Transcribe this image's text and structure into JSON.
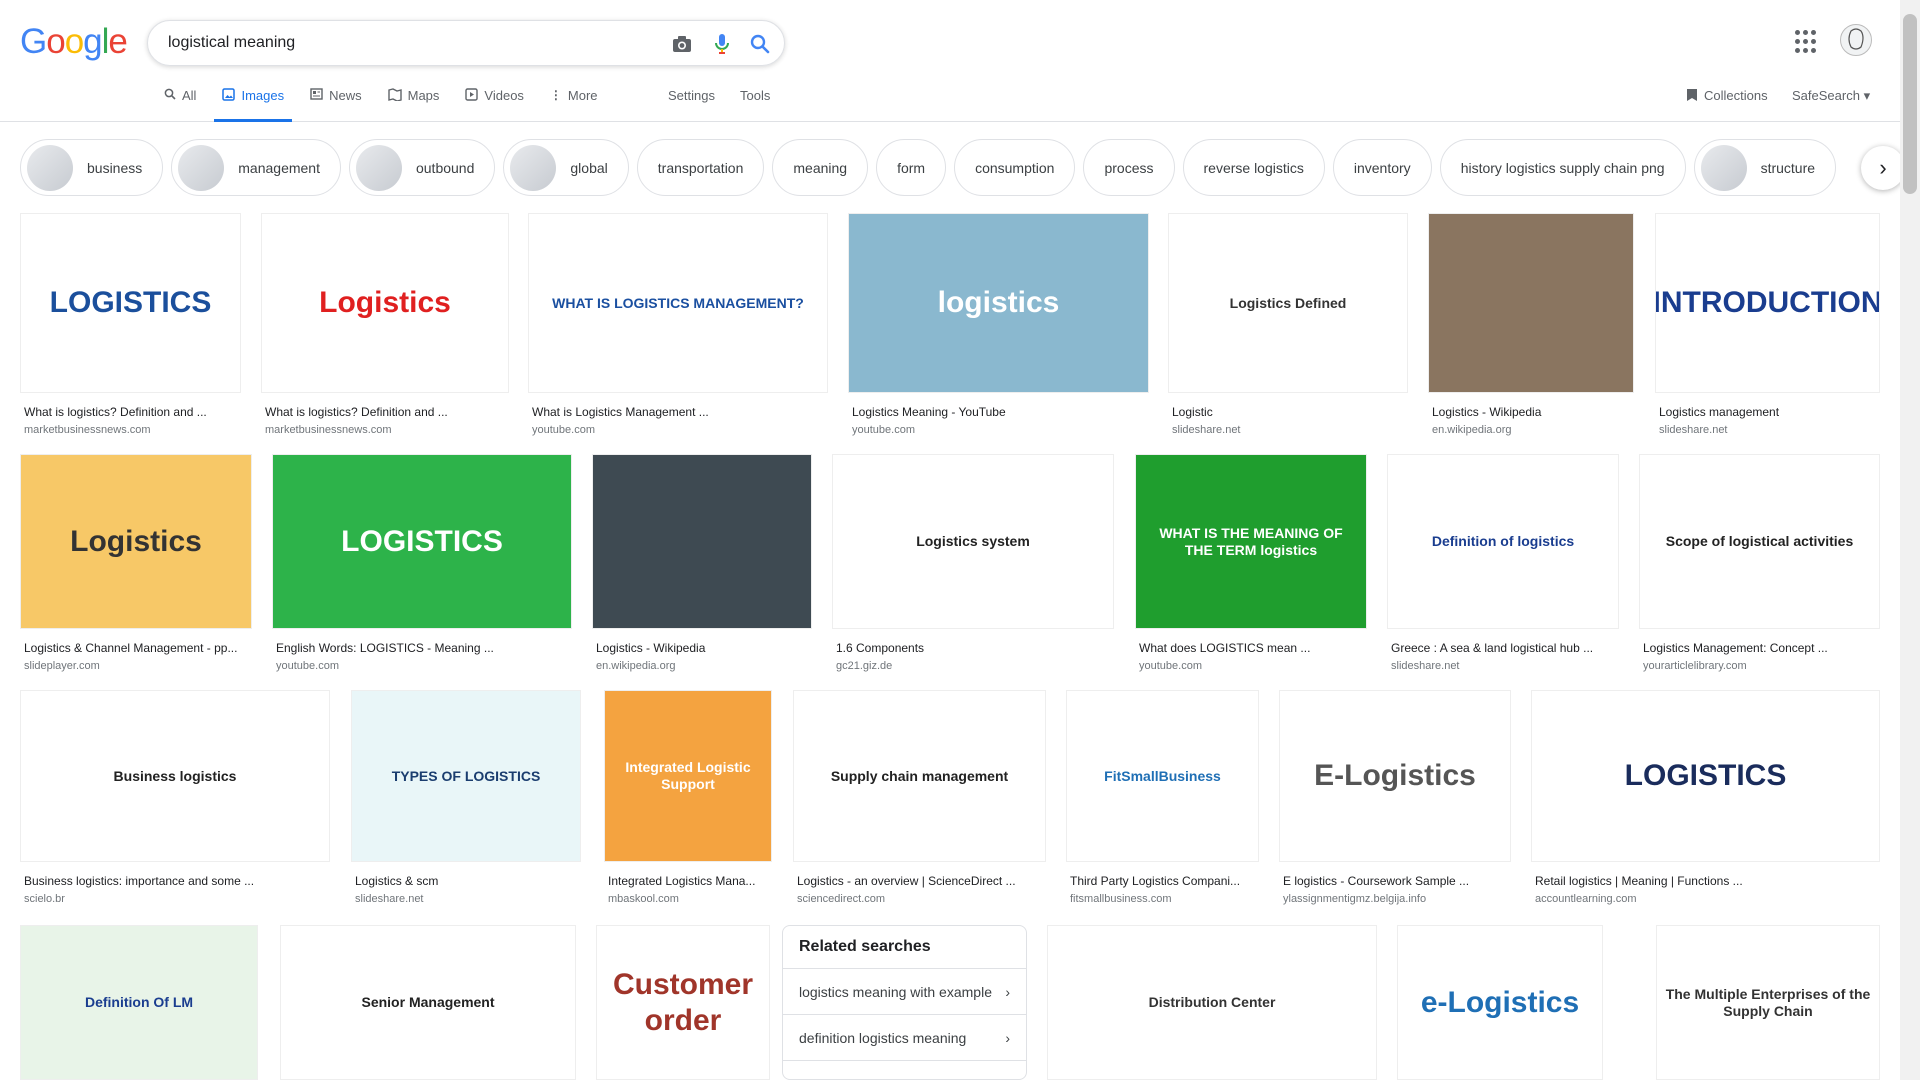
{
  "logo": {
    "letters": [
      "G",
      "o",
      "o",
      "g",
      "l",
      "e"
    ],
    "colors": [
      "#4285f4",
      "#ea4335",
      "#fbbc05",
      "#4285f4",
      "#34a853",
      "#ea4335"
    ]
  },
  "search": {
    "query": "logistical meaning",
    "camera_icon": "camera-icon",
    "mic_icon": "mic-icon",
    "search_icon": "search-icon"
  },
  "tabs": [
    {
      "label": "All",
      "icon": "search-icon"
    },
    {
      "label": "Images",
      "icon": "image-icon",
      "active": true
    },
    {
      "label": "News",
      "icon": "news-icon"
    },
    {
      "label": "Maps",
      "icon": "map-icon"
    },
    {
      "label": "Videos",
      "icon": "video-icon"
    },
    {
      "label": "More",
      "icon": "more-vert-icon"
    }
  ],
  "tools": {
    "settings": "Settings",
    "tools": "Tools"
  },
  "right_controls": {
    "collections": "Collections",
    "safesearch": "SafeSearch"
  },
  "chips": [
    {
      "label": "business",
      "thumb": true
    },
    {
      "label": "management",
      "thumb": true
    },
    {
      "label": "outbound",
      "thumb": true
    },
    {
      "label": "global",
      "thumb": true
    },
    {
      "label": "transportation"
    },
    {
      "label": "meaning"
    },
    {
      "label": "form"
    },
    {
      "label": "consumption"
    },
    {
      "label": "process"
    },
    {
      "label": "reverse logistics"
    },
    {
      "label": "inventory"
    },
    {
      "label": "history logistics supply chain png"
    },
    {
      "label": "structure",
      "thumb": true
    }
  ],
  "results_row1": [
    {
      "title": "What is logistics? Definition and ...",
      "source": "marketbusinessnews.com",
      "img_text": "LOGISTICS",
      "bg": "#ffffff",
      "fg": "#1b4f9c"
    },
    {
      "title": "What is logistics? Definition and ...",
      "source": "marketbusinessnews.com",
      "img_text": "Logistics",
      "bg": "#ffffff",
      "fg": "#e02020"
    },
    {
      "title": "What is Logistics Management ...",
      "source": "youtube.com",
      "img_text": "WHAT IS LOGISTICS MANAGEMENT?",
      "bg": "#ffffff",
      "fg": "#1a4fa0"
    },
    {
      "title": "Logistics Meaning - YouTube",
      "source": "youtube.com",
      "img_text": "logistics",
      "bg": "#8ab8cf",
      "fg": "#ffffff"
    },
    {
      "title": "Logistic",
      "source": "slideshare.net",
      "img_text": "Logistics Defined",
      "bg": "#ffffff",
      "fg": "#333333"
    },
    {
      "title": "Logistics - Wikipedia",
      "source": "en.wikipedia.org",
      "img_text": "",
      "bg": "#8a7560",
      "fg": "#ffffff"
    },
    {
      "title": "Logistics management",
      "source": "slideshare.net",
      "img_text": "INTRODUCTION",
      "bg": "#ffffff",
      "fg": "#1a3d8f"
    }
  ],
  "results_row2": [
    {
      "title": "Logistics & Channel Management - pp...",
      "source": "slideplayer.com",
      "img_text": "Logistics",
      "bg": "#f7c867",
      "fg": "#333333"
    },
    {
      "title": "English Words: LOGISTICS - Meaning ...",
      "source": "youtube.com",
      "img_text": "LOGISTICS",
      "bg": "#2db34a",
      "fg": "#ffffff"
    },
    {
      "title": "Logistics - Wikipedia",
      "source": "en.wikipedia.org",
      "img_text": "",
      "bg": "#3e4a52",
      "fg": "#ffffff"
    },
    {
      "title": "1.6 Components",
      "source": "gc21.giz.de",
      "img_text": "Logistics system",
      "bg": "#ffffff",
      "fg": "#222222"
    },
    {
      "title": "What does LOGISTICS mean ...",
      "source": "youtube.com",
      "img_text": "WHAT IS THE MEANING OF THE TERM logistics",
      "bg": "#1f9e2e",
      "fg": "#ffffff"
    },
    {
      "title": "Greece : A sea & land logistical hub ...",
      "source": "slideshare.net",
      "img_text": "Definition of logistics",
      "bg": "#ffffff",
      "fg": "#1a3d8f"
    },
    {
      "title": "Logistics Management: Concept ...",
      "source": "yourarticlelibrary.com",
      "img_text": "Scope of logistical activities",
      "bg": "#ffffff",
      "fg": "#222222"
    }
  ],
  "results_row3": [
    {
      "title": "Business logistics: importance and some ...",
      "source": "scielo.br",
      "img_text": "Business logistics",
      "bg": "#ffffff",
      "fg": "#222222"
    },
    {
      "title": "Logistics & scm",
      "source": "slideshare.net",
      "img_text": "TYPES OF LOGISTICS",
      "bg": "#e9f6f8",
      "fg": "#1a3d6f"
    },
    {
      "title": "Integrated Logistics Mana...",
      "source": "mbaskool.com",
      "img_text": "Integrated Logistic Support",
      "bg": "#f4a340",
      "fg": "#ffffff"
    },
    {
      "title": "Logistics - an overview | ScienceDirect ...",
      "source": "sciencedirect.com",
      "img_text": "Supply chain management",
      "bg": "#ffffff",
      "fg": "#222222"
    },
    {
      "title": "Third Party Logistics Compani...",
      "source": "fitsmallbusiness.com",
      "img_text": "FitSmallBusiness",
      "bg": "#ffffff",
      "fg": "#1f6fb5"
    },
    {
      "title": "E logistics - Coursework Sample ...",
      "source": "ylassignmentigmz.belgija.info",
      "img_text": "E-Logistics",
      "bg": "#ffffff",
      "fg": "#555555"
    },
    {
      "title": "Retail logistics | Meaning | Functions ...",
      "source": "accountlearning.com",
      "img_text": "LOGISTICS",
      "bg": "#ffffff",
      "fg": "#1a2c5c"
    }
  ],
  "results_row4": [
    {
      "img_text": "Definition Of LM",
      "bg": "#e8f4e8",
      "fg": "#1a3d8f"
    },
    {
      "img_text": "Senior Management",
      "bg": "#ffffff",
      "fg": "#222222"
    },
    {
      "img_text": "Customer order",
      "bg": "#ffffff",
      "fg": "#a0352a"
    },
    {
      "img_text": "Distribution Center",
      "bg": "#ffffff",
      "fg": "#333333"
    },
    {
      "img_text": "e-Logistics",
      "bg": "#ffffff",
      "fg": "#1f6fb5"
    },
    {
      "img_text": "The Multiple Enterprises of the Supply Chain",
      "bg": "#ffffff",
      "fg": "#333333"
    }
  ],
  "related": {
    "heading": "Related searches",
    "items": [
      "logistics meaning with example",
      "definition logistics meaning"
    ]
  }
}
